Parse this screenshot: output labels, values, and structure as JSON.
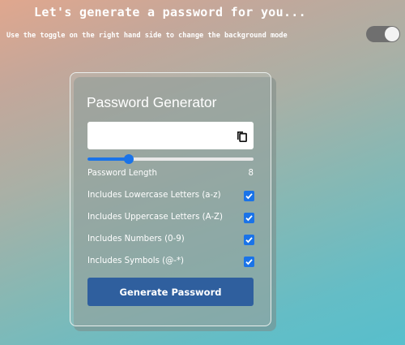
{
  "header": {
    "title": "Let's generate a password for you...",
    "subtitle": "Use the toggle on the right hand side to change the background mode"
  },
  "theme_toggle": {
    "state": "on"
  },
  "generator": {
    "title": "Password Generator",
    "password_value": "",
    "copy_icon": "copy-icon",
    "length": {
      "label": "Password Length",
      "value": "8",
      "slider_fraction": 0.25
    },
    "options": [
      {
        "label": "Includes Lowercase Letters (a-z)",
        "checked": true
      },
      {
        "label": "Includes Uppercase Letters (A-Z)",
        "checked": true
      },
      {
        "label": "Includes Numbers (0-9)",
        "checked": true
      },
      {
        "label": "Includes Symbols (@-*)",
        "checked": true
      }
    ],
    "button_label": "Generate Password"
  },
  "colors": {
    "accent": "#1a73e8",
    "button": "#2f5f9e"
  }
}
